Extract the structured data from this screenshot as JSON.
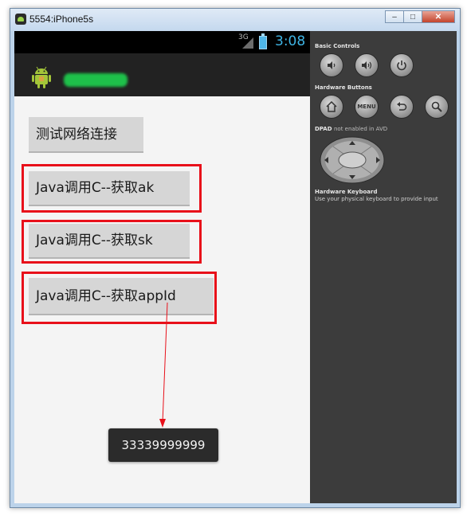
{
  "window": {
    "title": "5554:iPhone5s",
    "controls": {
      "minimize": "–",
      "maximize": "□",
      "close": "✕"
    }
  },
  "status_bar": {
    "network": "3G",
    "time": "3:08"
  },
  "action_bar": {
    "app_icon": "android-icon"
  },
  "buttons": [
    {
      "label": "测试网络连接"
    },
    {
      "label": "Java调用C--获取ak"
    },
    {
      "label": "Java调用C--获取sk"
    },
    {
      "label": "Java调用C--获取appId"
    }
  ],
  "toast": {
    "text": "33339999999"
  },
  "panel": {
    "basic_controls_label": "Basic Controls",
    "hardware_buttons_label": "Hardware Buttons",
    "menu_label": "MENU",
    "dpad_label": "DPAD",
    "dpad_note": "not enabled in AVD",
    "keyboard_label": "Hardware Keyboard",
    "keyboard_note": "Use your physical keyboard to provide input",
    "basic_controls": [
      "volume-down-icon",
      "volume-up-icon",
      "power-icon"
    ],
    "hardware_buttons": [
      "home-icon",
      "menu-icon",
      "back-icon",
      "search-icon"
    ]
  },
  "colors": {
    "highlight": "#e8101a",
    "accent_blue": "#3fb5e5",
    "blurred_title": "#1ec04a"
  }
}
